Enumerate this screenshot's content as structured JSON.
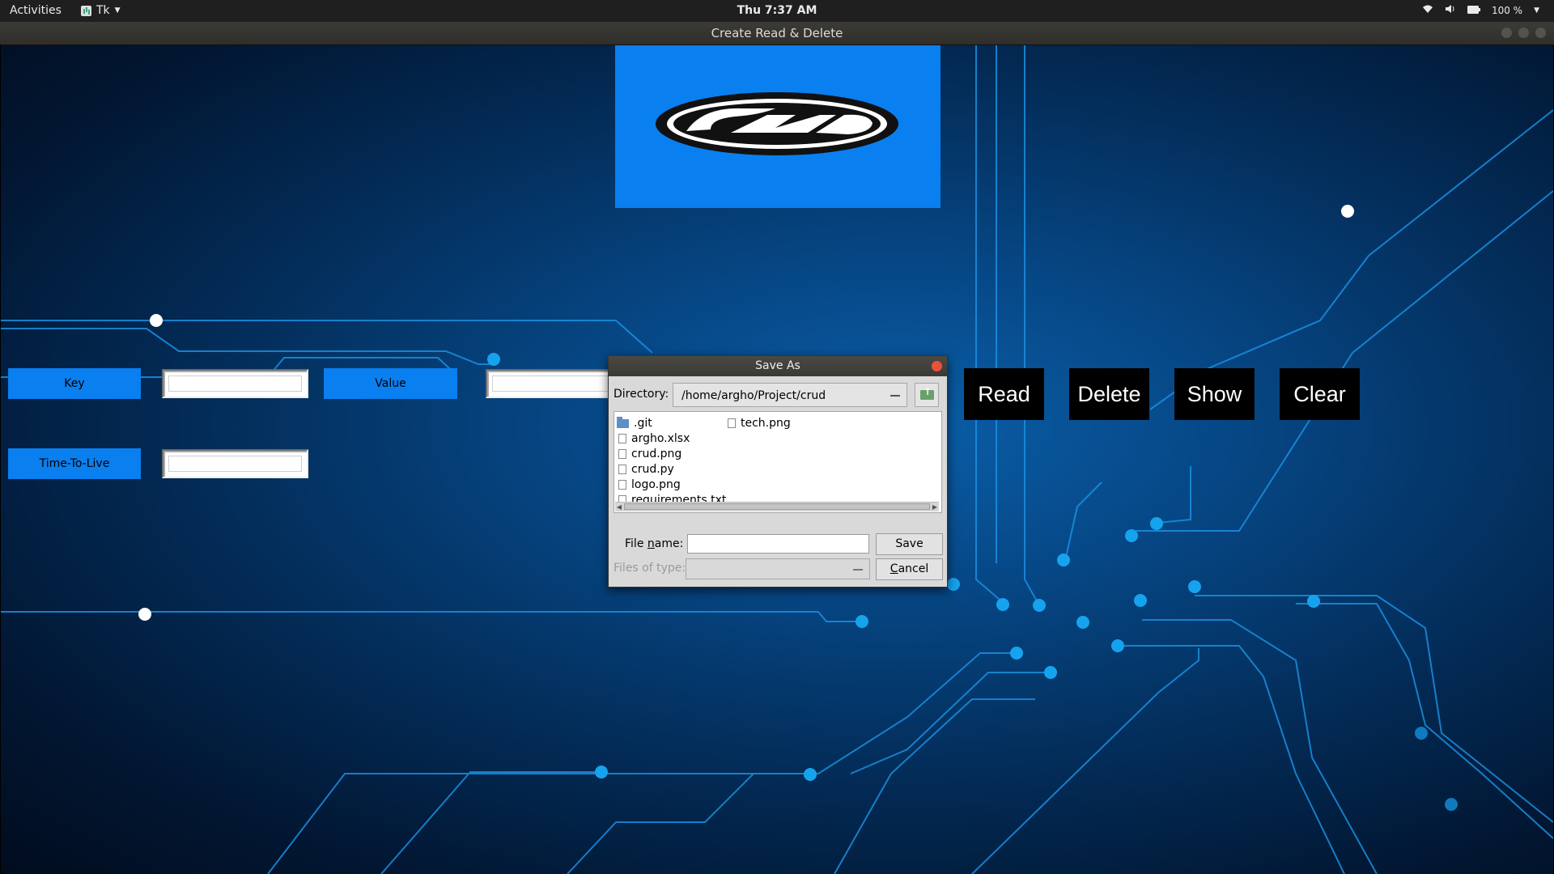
{
  "topbar": {
    "activities": "Activities",
    "app_name": "Tk",
    "clock": "Thu  7:37 AM",
    "battery": "100 %"
  },
  "window": {
    "title": "Create Read & Delete"
  },
  "form": {
    "key_label": "Key",
    "value_label": "Value",
    "ttl_label": "Time-To-Live",
    "key_value": "",
    "value_value": "",
    "ttl_value": ""
  },
  "actions": {
    "read": "Read",
    "delete": "Delete",
    "show": "Show",
    "clear": "Clear"
  },
  "dialog": {
    "title": "Save As",
    "directory_label": "Directory:",
    "directory_value": "/home/argho/Project/crud",
    "files": [
      {
        "name": ".git",
        "type": "folder"
      },
      {
        "name": "argho.xlsx",
        "type": "file"
      },
      {
        "name": "crud.png",
        "type": "file"
      },
      {
        "name": "crud.py",
        "type": "file"
      },
      {
        "name": "logo.png",
        "type": "file"
      },
      {
        "name": "requirements.txt",
        "type": "file"
      },
      {
        "name": "tech.png",
        "type": "file"
      }
    ],
    "file_name_label_pre": "File ",
    "file_name_label_ul": "n",
    "file_name_label_post": "ame:",
    "file_name_value": "",
    "files_of_type_label": "Files of type:",
    "save_button": "Save",
    "cancel_button_ul": "C",
    "cancel_button_rest": "ancel"
  },
  "colors": {
    "accent_blue": "#0a7fef",
    "action_bg": "#000000",
    "close_red": "#e8523b"
  }
}
